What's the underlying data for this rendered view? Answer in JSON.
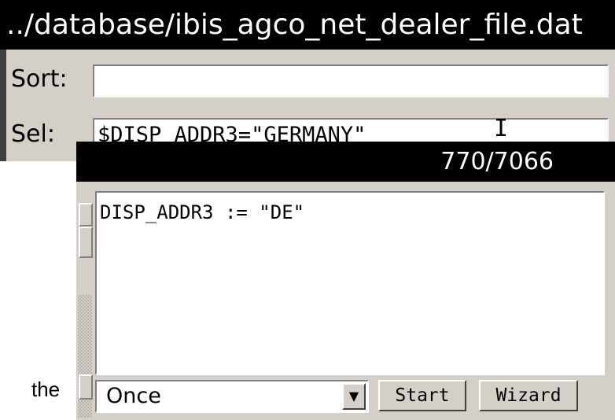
{
  "back_window": {
    "title": "../database/ibis_agco_net_dealer_file.dat",
    "sort_label": "Sort:",
    "sort_value": "",
    "sel_label": "Sel:",
    "sel_value": "$DISP_ADDR3=\"GERMANY\"",
    "cursor_glyph": "I"
  },
  "front_window": {
    "record_counter": "770/7066",
    "editor_text": "DISP_ADDR3 := \"DE\"",
    "frequency_value": "Once",
    "dropdown_glyph": "▼",
    "start_label": "Start",
    "wizard_label": "Wizard"
  },
  "background_text": "the"
}
